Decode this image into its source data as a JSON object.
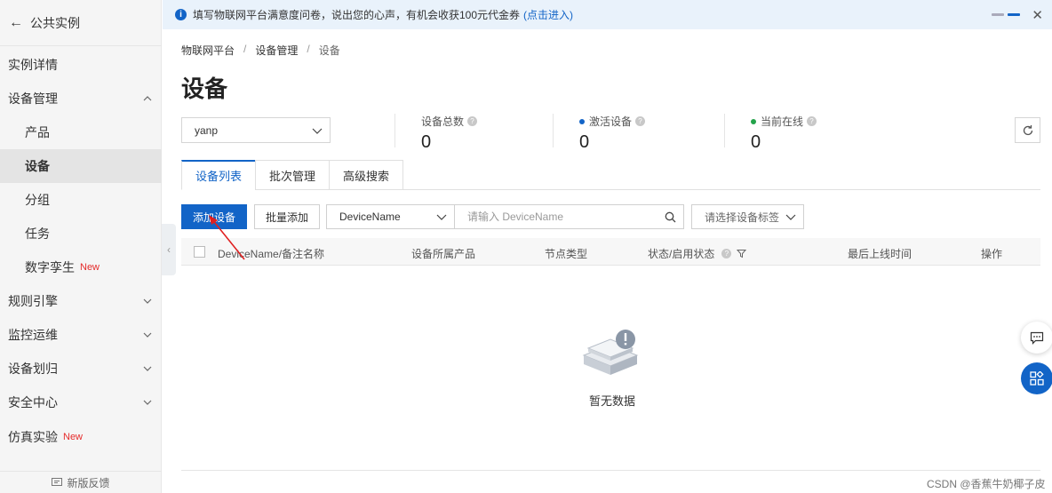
{
  "sidebar": {
    "back_label": "公共实例",
    "items": [
      {
        "label": "实例详情",
        "level": "top"
      },
      {
        "label": "设备管理",
        "level": "top",
        "expanded": true
      },
      {
        "label": "产品",
        "level": "sub"
      },
      {
        "label": "设备",
        "level": "sub",
        "active": true
      },
      {
        "label": "分组",
        "level": "sub"
      },
      {
        "label": "任务",
        "level": "sub"
      },
      {
        "label": "数字孪生",
        "level": "sub",
        "badge": "New"
      },
      {
        "label": "规则引擎",
        "level": "top"
      },
      {
        "label": "监控运维",
        "level": "top"
      },
      {
        "label": "设备划归",
        "level": "top"
      },
      {
        "label": "安全中心",
        "level": "top"
      },
      {
        "label": "仿真实验",
        "level": "top",
        "badge": "New"
      }
    ],
    "feedback_label": "新版反馈"
  },
  "notice": {
    "text": "填写物联网平台满意度问卷，说出您的心声，有机会收获100元代金券",
    "link": "(点击进入)"
  },
  "breadcrumb": [
    "物联网平台",
    "设备管理",
    "设备"
  ],
  "page_title": "设备",
  "product_select": {
    "value": "yanp"
  },
  "stats": [
    {
      "label": "设备总数",
      "value": "0",
      "dot_color": ""
    },
    {
      "label": "激活设备",
      "value": "0",
      "dot_color": "#1264c7"
    },
    {
      "label": "当前在线",
      "value": "0",
      "dot_color": "#23a34a"
    }
  ],
  "tabs": [
    {
      "label": "设备列表",
      "active": true
    },
    {
      "label": "批次管理"
    },
    {
      "label": "高级搜索"
    }
  ],
  "toolbar": {
    "add_device": "添加设备",
    "batch_add": "批量添加",
    "field_select": "DeviceName",
    "search_placeholder": "请输入 DeviceName",
    "tag_select": "请选择设备标签"
  },
  "table": {
    "columns": [
      "DeviceName/备注名称",
      "设备所属产品",
      "节点类型",
      "状态/启用状态",
      "最后上线时间",
      "操作"
    ],
    "rows": []
  },
  "empty_text": "暂无数据",
  "watermark": "CSDN @香蕉牛奶椰子皮",
  "colors": {
    "accent": "#1264c7",
    "new_badge": "#e52b2b",
    "online": "#23a34a"
  }
}
